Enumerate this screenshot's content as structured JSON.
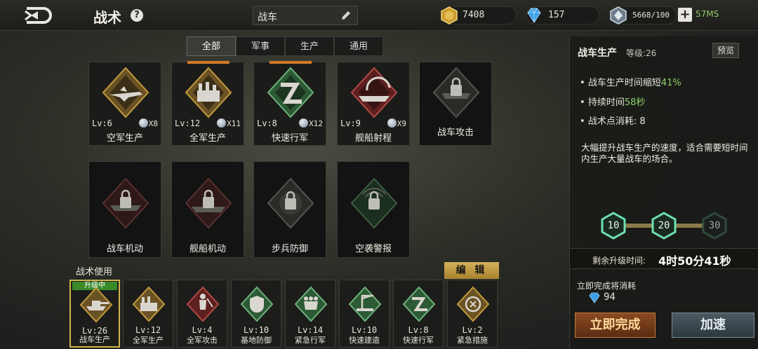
{
  "header": {
    "title": "战术",
    "help": "?",
    "search_value": "战车",
    "gold": "7408",
    "gems": "157",
    "supply": "5668/100",
    "network": "57MS"
  },
  "tabs": [
    "全部",
    "军事",
    "生产",
    "通用"
  ],
  "cards": [
    {
      "level": "Lv:6",
      "count": "X8",
      "name": "空军生产"
    },
    {
      "level": "Lv:12",
      "count": "X11",
      "name": "全军生产"
    },
    {
      "level": "Lv:8",
      "count": "X12",
      "name": "快速行军"
    },
    {
      "level": "Lv:9",
      "count": "X9",
      "name": "舰船射程"
    },
    {
      "level": "",
      "count": "",
      "name": "战车攻击"
    },
    {
      "level": "",
      "count": "",
      "name": "战车机动"
    },
    {
      "level": "",
      "count": "",
      "name": "舰船机动"
    },
    {
      "level": "",
      "count": "",
      "name": "步兵防御"
    },
    {
      "level": "",
      "count": "",
      "name": "空袭警报"
    }
  ],
  "usage": {
    "label": "战术使用",
    "edit_label": "编 辑",
    "upgrading_badge": "升级中",
    "slots": [
      {
        "level": "Lv:26",
        "name": "战车生产"
      },
      {
        "level": "Lv:12",
        "name": "全军生产"
      },
      {
        "level": "Lv:4",
        "name": "全军攻击"
      },
      {
        "level": "Lv:10",
        "name": "基地防御"
      },
      {
        "level": "Lv:14",
        "name": "紧急行军"
      },
      {
        "level": "Lv:10",
        "name": "快速建造"
      },
      {
        "level": "Lv:8",
        "name": "快速行军"
      },
      {
        "level": "Lv:2",
        "name": "紧急措施"
      }
    ]
  },
  "detail": {
    "title": "战车生产",
    "level": "等级:26",
    "preview_label": "预览",
    "stat1_prefix": "战车生产时间缩短",
    "stat1_value": "41%",
    "stat2_prefix": "持续时间",
    "stat2_value": "58秒",
    "stat3": "战术点消耗: 8",
    "description": "大幅提升战车生产的速度，适合需要短时间内生产大量战车的场合。",
    "milestones": [
      "10",
      "20",
      "30"
    ],
    "remaining_label": "剩余升级时间:",
    "remaining_time": "4时50分41秒",
    "instant_label": "立即完成将消耗",
    "instant_cost": "94",
    "complete_label": "立即完成",
    "speedup_label": "加速"
  },
  "colors": {
    "accent_gold": "#d6b15a",
    "upgrade_green": "#3a8a2a",
    "stat_green": "#8fd06a"
  }
}
